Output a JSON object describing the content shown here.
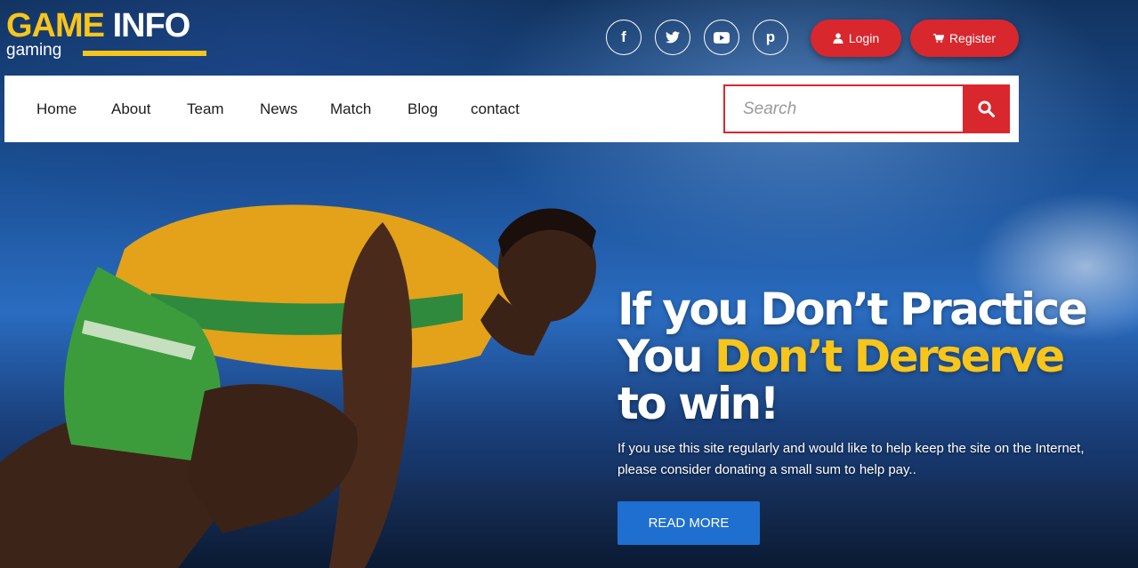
{
  "logo": {
    "word1": "GAME",
    "word2": "INFO",
    "sub": "gaming"
  },
  "social": [
    {
      "icon": "facebook-icon",
      "glyph": "f"
    },
    {
      "icon": "twitter-icon",
      "glyph": "t"
    },
    {
      "icon": "youtube-icon",
      "glyph": "▶"
    },
    {
      "icon": "pinterest-icon",
      "glyph": "p"
    }
  ],
  "header": {
    "login_label": "Login",
    "register_label": "Register"
  },
  "nav": {
    "items": [
      "Home",
      "About",
      "Team",
      "News",
      "Match",
      "Blog",
      "contact"
    ]
  },
  "search": {
    "placeholder": "Search",
    "value": ""
  },
  "hero": {
    "line1": "If you Don’t Practice",
    "line2_a": "You ",
    "line2_b": "Don’t Derserve",
    "line3": "to win!",
    "text_line1": "If you use this site regularly and would like to help keep the site on the Internet,",
    "text_line2": "please consider donating a small sum to help pay..",
    "cta": "READ MORE"
  },
  "colors": {
    "accent_yellow": "#f8c51b",
    "accent_red": "#d9272e",
    "cta_blue": "#1e6fd0"
  }
}
